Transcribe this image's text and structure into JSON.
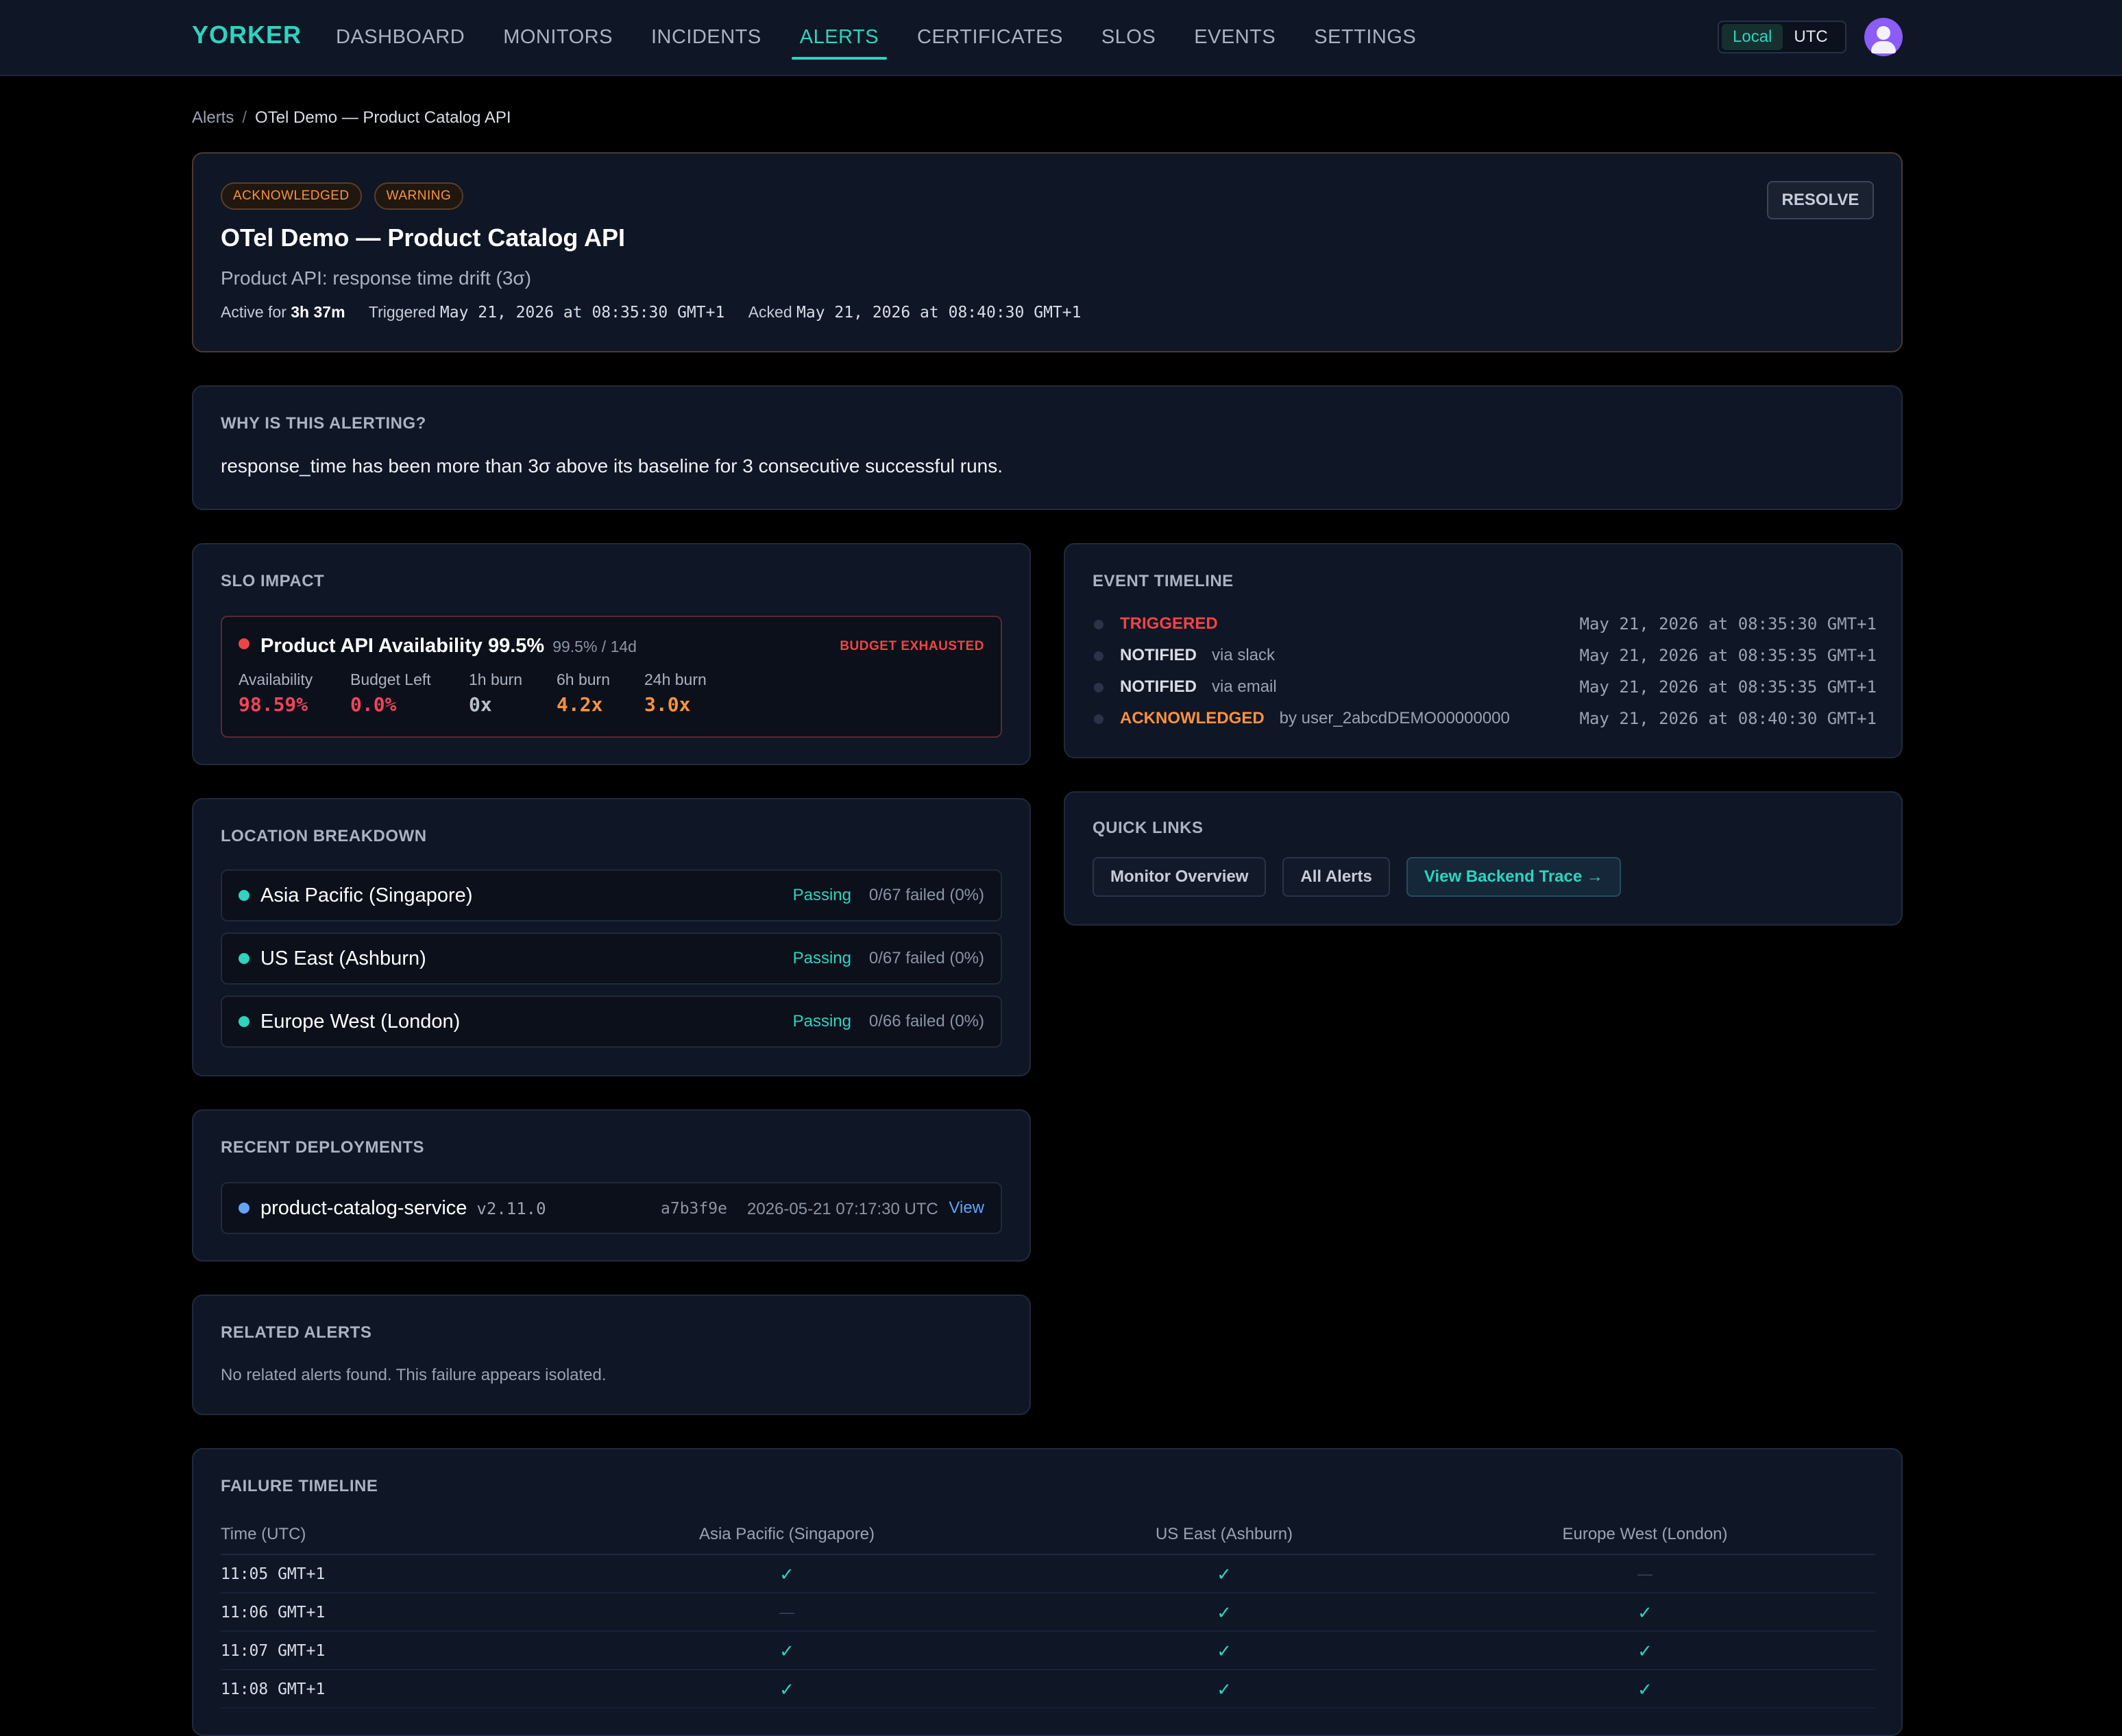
{
  "nav": {
    "brand": "YORKER",
    "links": [
      "DASHBOARD",
      "MONITORS",
      "INCIDENTS",
      "ALERTS",
      "CERTIFICATES",
      "SLOS",
      "EVENTS",
      "SETTINGS"
    ],
    "active": "ALERTS",
    "tz_local": "Local",
    "tz_utc": "UTC",
    "tz_selected": "Local"
  },
  "breadcrumb": {
    "parent": "Alerts",
    "separator": "/",
    "current": "OTel Demo — Product Catalog API"
  },
  "alert": {
    "badges": [
      "ACKNOWLEDGED",
      "WARNING"
    ],
    "resolve_label": "RESOLVE",
    "title": "OTel Demo — Product Catalog API",
    "subtitle": "Product API: response time drift (3σ)",
    "active_label": "Active for",
    "active_value": "3h 37m",
    "triggered_label": "Triggered",
    "triggered_value": "May 21, 2026 at 08:35:30 GMT+1",
    "acked_label": "Acked",
    "acked_value": "May 21, 2026 at 08:40:30 GMT+1"
  },
  "why": {
    "title": "WHY IS THIS ALERTING?",
    "text": "response_time has been more than 3σ above its baseline for 3 consecutive successful runs."
  },
  "slo_impact": {
    "title": "SLO IMPACT",
    "name": "Product API Availability 99.5%",
    "target": "99.5% / 14d",
    "status": "BUDGET EXHAUSTED",
    "metrics": [
      {
        "label": "Availability",
        "value": "98.59%"
      },
      {
        "label": "Budget Left",
        "value": "0.0%"
      },
      {
        "label": "1h burn",
        "value": "0x"
      },
      {
        "label": "6h burn",
        "value": "4.2x"
      },
      {
        "label": "24h burn",
        "value": "3.0x"
      }
    ]
  },
  "event_timeline": {
    "title": "EVENT TIMELINE",
    "events": [
      {
        "kind": "TRIGGERED",
        "detail": "",
        "time": "May 21, 2026 at 08:35:30 GMT+1",
        "color": "#ef4444"
      },
      {
        "kind": "NOTIFIED",
        "detail": "via slack",
        "time": "May 21, 2026 at 08:35:35 GMT+1",
        "color": "#d9dee6"
      },
      {
        "kind": "NOTIFIED",
        "detail": "via email",
        "time": "May 21, 2026 at 08:35:35 GMT+1",
        "color": "#d9dee6"
      },
      {
        "kind": "ACKNOWLEDGED",
        "detail": "by user_2abcdDEMO00000000",
        "time": "May 21, 2026 at 08:40:30 GMT+1",
        "color": "#fb923c"
      }
    ]
  },
  "quick_links": {
    "title": "QUICK LINKS",
    "links": [
      "Monitor Overview",
      "All Alerts",
      "View Backend Trace →"
    ]
  },
  "location_breakdown": {
    "title": "LOCATION BREAKDOWN",
    "locations": [
      {
        "name": "Asia Pacific (Singapore)",
        "status": "Passing",
        "failed": "0/67 failed (0%)"
      },
      {
        "name": "US East (Ashburn)",
        "status": "Passing",
        "failed": "0/67 failed (0%)"
      },
      {
        "name": "Europe West (London)",
        "status": "Passing",
        "failed": "0/66 failed (0%)"
      }
    ]
  },
  "deployments": {
    "title": "RECENT DEPLOYMENTS",
    "items": [
      {
        "service": "product-catalog-service",
        "version": "v2.11.0",
        "sha": "a7b3f9e",
        "time": "2026-05-21 07:17:30 UTC",
        "view": "View"
      }
    ]
  },
  "related": {
    "title": "RELATED ALERTS",
    "text": "No related alerts found. This failure appears isolated."
  },
  "failure_timeline": {
    "title": "FAILURE TIMELINE",
    "columns": [
      "Time (UTC)",
      "Asia Pacific (Singapore)",
      "US East (Ashburn)",
      "Europe West (London)"
    ],
    "rows": [
      {
        "time": "11:05 GMT+1",
        "cells": [
          "✓",
          "✓",
          "—"
        ]
      },
      {
        "time": "11:06 GMT+1",
        "cells": [
          "—",
          "✓",
          "✓"
        ]
      },
      {
        "time": "11:07 GMT+1",
        "cells": [
          "✓",
          "✓",
          "✓"
        ]
      },
      {
        "time": "11:08 GMT+1",
        "cells": [
          "✓",
          "✓",
          "✓"
        ]
      }
    ]
  }
}
